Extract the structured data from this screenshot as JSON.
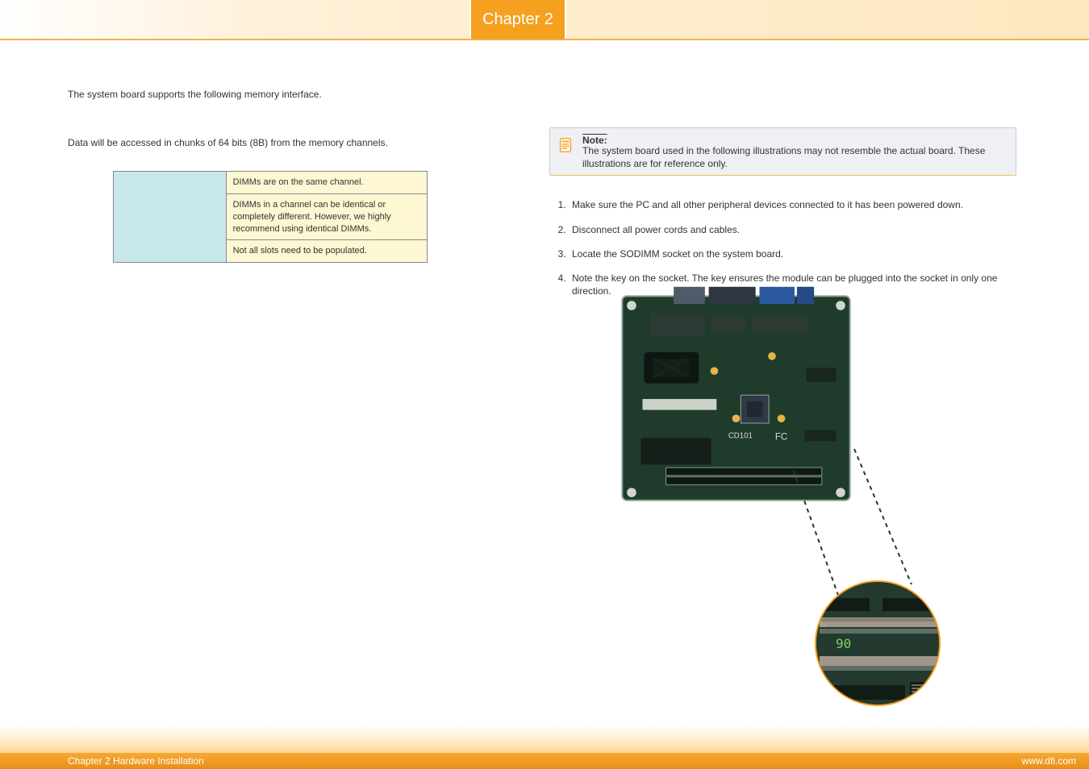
{
  "header": {
    "chapter_tab": "Chapter 2"
  },
  "left": {
    "intro": "The system board supports the following memory interface.",
    "subtext": "Data will be accessed in chunks of 64 bits (8B) from the memory channels.",
    "table": {
      "row1_right": "DIMMs are on the same channel.",
      "row2_right": "DIMMs in a channel can be identical or completely different. However, we highly recommend using identical DIMMs.",
      "row3_right": "Not all slots need to be populated."
    }
  },
  "right": {
    "note": {
      "title": "Note:",
      "body": "The system board used in the following illustrations may not resemble the actual board. These illustrations are for reference only."
    },
    "steps": {
      "s1": "Make sure the PC and all other peripheral devices connected to it has been powered down.",
      "s2": "Disconnect all power cords and cables.",
      "s3": "Locate the SODIMM socket on the system board.",
      "s4": "Note the key on the socket. The key ensures the module can be plugged into the socket in only one direction."
    },
    "zoom_label": "90"
  },
  "footer": {
    "left": "Chapter 2 Hardware Installation",
    "right": "www.dfi.com"
  }
}
